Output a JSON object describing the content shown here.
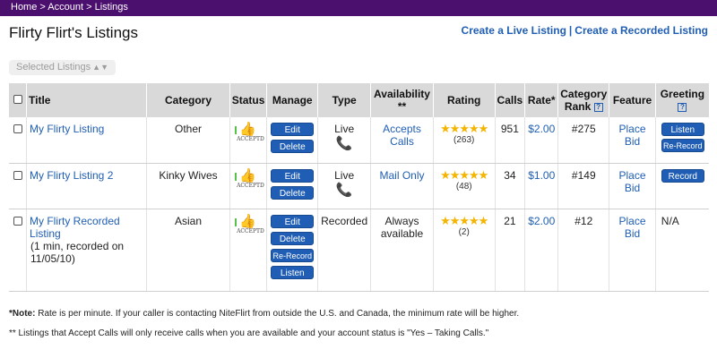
{
  "breadcrumb": {
    "home": "Home",
    "sep1": " > ",
    "account": "Account",
    "sep2": " > ",
    "current": "Listings"
  },
  "page_title": "Flirty Flirt's Listings",
  "create_links": {
    "live": "Create a Live Listing",
    "separator": "|",
    "recorded": "Create a Recorded Listing"
  },
  "selector": {
    "placeholder": "Selected Listings",
    "chevron": "⌃⌄"
  },
  "table": {
    "headers": {
      "title": "Title",
      "category": "Category",
      "status": "Status",
      "manage": "Manage",
      "type": "Type",
      "availability": "Availability **",
      "rating": "Rating",
      "calls": "Calls",
      "rate": "Rate*",
      "category_rank": "Category Rank",
      "feature": "Feature",
      "greeting": "Greeting"
    },
    "help_glyph": "?",
    "status_badge_text": "ACCEPTD",
    "stars": "★★★★★",
    "rows": [
      {
        "title": "My Flirty Listing",
        "title_note": "",
        "category": "Other",
        "manage": [
          "Edit",
          "Delete"
        ],
        "type": "Live",
        "type_icon": "phone-icon",
        "availability": "Accepts Calls",
        "rating_count": "(263)",
        "calls": "951",
        "rate": "$2.00",
        "rank": "#275",
        "feature": "Place Bid",
        "greeting": [
          "Listen",
          "Re-Record"
        ]
      },
      {
        "title": "My Flirty Listing 2",
        "title_note": "",
        "category": "Kinky Wives",
        "manage": [
          "Edit",
          "Delete"
        ],
        "type": "Live",
        "type_icon": "phone-icon",
        "availability": "Mail Only",
        "rating_count": "(48)",
        "calls": "34",
        "rate": "$1.00",
        "rank": "#149",
        "feature": "Place Bid",
        "greeting": [
          "Record"
        ]
      },
      {
        "title": "My Flirty Recorded Listing",
        "title_note": "(1  min, recorded on 11/05/10)",
        "category": "Asian",
        "manage": [
          "Edit",
          "Delete",
          "Re-Record",
          "Listen"
        ],
        "type": "Recorded",
        "availability": "Always available",
        "rating_count": "(2)",
        "calls": "21",
        "rate": "$2.00",
        "rank": "#12",
        "feature": "Place Bid",
        "greeting_text": "N/A"
      }
    ]
  },
  "notes": {
    "note_label": "*Note:",
    "note_text": " Rate is per minute. If your caller is contacting NiteFlirt from outside the U.S. and Canada, the minimum rate will be higher.",
    "note2": "** Listings that Accept Calls will only receive calls when you are available and your account status is \"Yes – Taking Calls.\""
  },
  "colors": {
    "topbar": "#4b0f6e",
    "link": "#1f5eb4",
    "button": "#1f5eb4",
    "star": "#f4b400",
    "phone": "#6a1d8a"
  }
}
